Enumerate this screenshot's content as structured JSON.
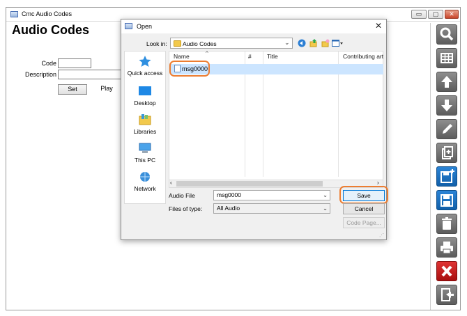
{
  "main": {
    "title": "Cmc Audio Codes",
    "heading": "Audio Codes",
    "code_label": "Code",
    "description_label": "Description",
    "code_value": "",
    "description_value": "",
    "set_label": "Set",
    "play_label": "Play",
    "caption_min": "▭",
    "caption_max": "▢",
    "caption_close": "✕"
  },
  "toolbar": {
    "icons": [
      "search-icon",
      "grid-icon",
      "arrow-up-icon",
      "arrow-down-icon",
      "edit-icon",
      "copy-icon",
      "new-record-icon",
      "save-icon",
      "delete-icon",
      "print-icon",
      "close-icon",
      "exit-icon"
    ]
  },
  "dialog": {
    "title": "Open",
    "close_glyph": "✕",
    "look_in_label": "Look in:",
    "look_in_value": "Audio Codes",
    "places": [
      "Quick access",
      "Desktop",
      "Libraries",
      "This PC",
      "Network"
    ],
    "columns": [
      "Name",
      "#",
      "Title",
      "Contributing art"
    ],
    "files": [
      "msg0000"
    ],
    "audio_file_label": "Audio File",
    "audio_file_value": "msg0000",
    "files_of_type_label": "Files of type:",
    "files_of_type_value": "All Audio",
    "save_label": "Save",
    "cancel_label": "Cancel",
    "code_page_label": "Code Page..."
  },
  "colors": {
    "highlight": "#ed7d31",
    "selection": "#cce5ff",
    "toolbar_blue": "#1f73c4",
    "toolbar_red": "#c62020"
  }
}
